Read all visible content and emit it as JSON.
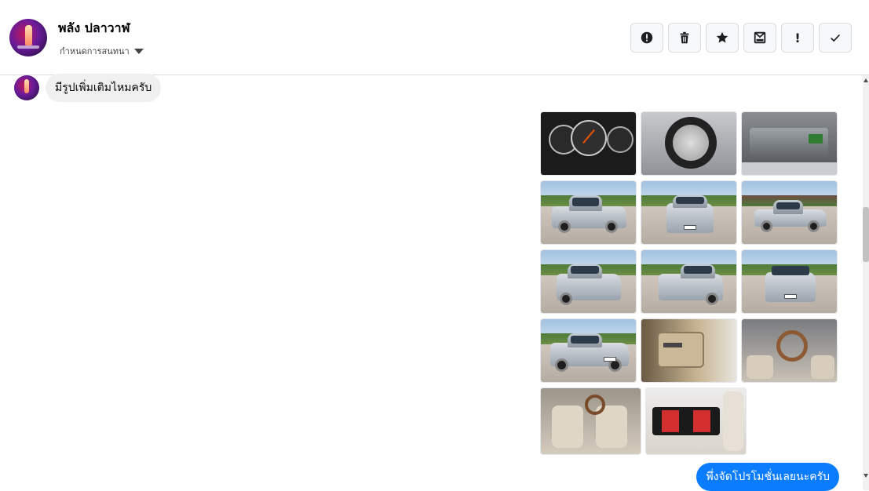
{
  "header": {
    "contact_name": "พลัง ปลาวาฬ",
    "subtitle": "กำหนดการสนทนา",
    "actions": [
      {
        "name": "spam-button",
        "icon": "exclamation-circle-icon"
      },
      {
        "name": "delete-button",
        "icon": "trash-icon"
      },
      {
        "name": "star-button",
        "icon": "star-icon"
      },
      {
        "name": "unread-button",
        "icon": "envelope-icon"
      },
      {
        "name": "follow-up-button",
        "icon": "exclamation-icon",
        "glyph": "!"
      },
      {
        "name": "done-button",
        "icon": "check-icon"
      }
    ]
  },
  "messages": {
    "incoming_text": "มีรูปเพิ่มเติมไหมครับ",
    "outgoing_text": "พึ่งจัดโปรโมชั่นเลยนะครับ"
  },
  "photos": [
    {
      "name": "photo-dashboard",
      "icon": "dashboard-photo"
    },
    {
      "name": "photo-wheel",
      "icon": "wheel-photo"
    },
    {
      "name": "photo-engine",
      "icon": "engine-photo"
    },
    {
      "name": "photo-front-left",
      "icon": "truck-photo"
    },
    {
      "name": "photo-rear",
      "icon": "truck-photo"
    },
    {
      "name": "photo-side",
      "icon": "truck-photo"
    },
    {
      "name": "photo-rear-left",
      "icon": "truck-photo"
    },
    {
      "name": "photo-rear-right",
      "icon": "truck-photo"
    },
    {
      "name": "photo-front",
      "icon": "truck-photo"
    },
    {
      "name": "photo-front-angle",
      "icon": "truck-photo"
    },
    {
      "name": "photo-door",
      "icon": "door-photo"
    },
    {
      "name": "photo-steering",
      "icon": "steering-photo"
    },
    {
      "name": "photo-seats",
      "icon": "seat-photo"
    },
    {
      "name": "photo-seat-cover",
      "icon": "seat-photo"
    }
  ],
  "colors": {
    "outgoing_bubble": "#0a7cff",
    "incoming_bubble": "#f0f0f0"
  }
}
